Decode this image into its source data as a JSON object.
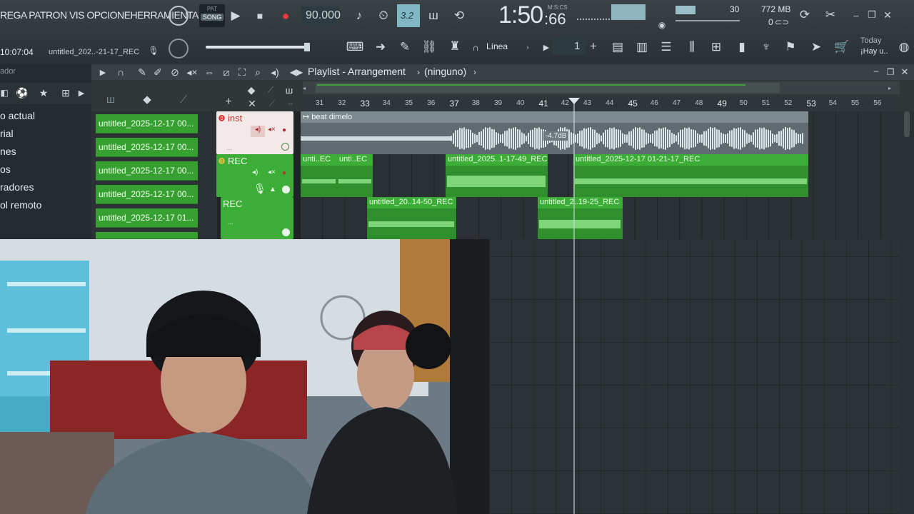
{
  "menu": {
    "text": "REGA PATRON VIS OPCIONEHERRAMIENTA"
  },
  "clock_small": "10:07:04",
  "project_title": "untitled_202..-21-17_REC",
  "transport": {
    "pat_label": "PAT",
    "song_label": "SONG",
    "tempo": "90.000",
    "time_main": "1:50",
    "time_sub": ":66",
    "time_unit": "M:S:CS",
    "snap_label": "3.2"
  },
  "monitor": {
    "cpu_value": "30",
    "mem_value": "772 MB",
    "poly_value": "0"
  },
  "row2": {
    "line_label": "Línea",
    "step_value": "1",
    "news_title": "Today",
    "news_text": "¡Hay u.."
  },
  "browser": {
    "title": "ador",
    "items": [
      {
        "label": "o actual"
      },
      {
        "label": "rial"
      },
      {
        "label": "nes"
      },
      {
        "label": "os"
      },
      {
        "label": "radores"
      },
      {
        "label": "ol remoto"
      }
    ]
  },
  "playlist": {
    "title": "Playlist - Arrangement",
    "pattern_selector": "(ninguno)",
    "patterns": [
      {
        "label": "untitled_2025-12-17 00..."
      },
      {
        "label": "untitled_2025-12-17 00..."
      },
      {
        "label": "untitled_2025-12-17 00..."
      },
      {
        "label": "untitled_2025-12-17 00..."
      },
      {
        "label": "untitled_2025-12-17 01..."
      }
    ],
    "tracks": [
      {
        "name": "inst"
      },
      {
        "name": "REC"
      },
      {
        "name": "REC"
      }
    ],
    "ruler": [
      "31",
      "32",
      "33",
      "34",
      "35",
      "36",
      "37",
      "38",
      "39",
      "40",
      "41",
      "42",
      "43",
      "44",
      "45",
      "46",
      "47",
      "48",
      "49",
      "50",
      "51",
      "52",
      "53",
      "54",
      "55",
      "56"
    ],
    "clips": [
      {
        "title": "beat dimelo",
        "gain": "-4.7dB"
      },
      {
        "title": "unti..EC"
      },
      {
        "title": "unti..EC"
      },
      {
        "title": "untitled_2025..1-17-49_REC"
      },
      {
        "title": "untitled_2025-12-17 01-21-17_REC"
      },
      {
        "title": "untitled_20..14-50_REC"
      },
      {
        "title": "untitled_2..19-25_REC"
      }
    ]
  },
  "colors": {
    "clip_green": "#3cae37",
    "clip_gray": "#7d8b90",
    "track_inst": "#f3e9e9",
    "track_rec": "#3cae37"
  }
}
